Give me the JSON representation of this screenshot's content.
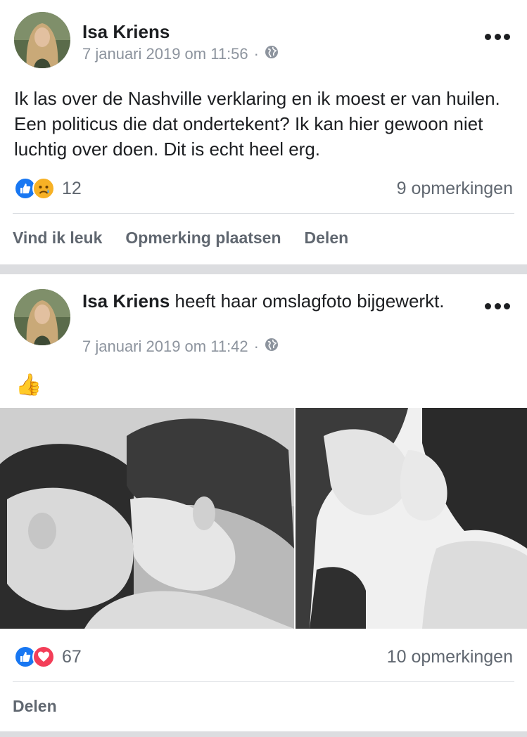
{
  "posts": [
    {
      "author": "Isa Kriens",
      "action": "",
      "date": "7 januari 2019 om 11:56",
      "separator": "·",
      "privacy_icon": "globe-icon",
      "text": "Ik las over de Nashville verklaring en ik moest er van huilen. Een politicus die dat ondertekent? Ik kan hier gewoon niet luchtig over doen. Dit is echt heel erg.",
      "reactions": [
        "like",
        "sad"
      ],
      "reaction_count": "12",
      "comments": "9 opmerkingen",
      "actions": [
        "Vind ik leuk",
        "Opmerking plaatsen",
        "Delen"
      ]
    },
    {
      "author": "Isa Kriens",
      "action": " heeft haar omslagfoto bijgewerkt.",
      "date": "7 januari 2019 om 11:42",
      "separator": "·",
      "privacy_icon": "globe-icon",
      "text_emoji": "👍",
      "reactions": [
        "like",
        "love"
      ],
      "reaction_count": "67",
      "comments": "10 opmerkingen",
      "actions": [
        "Delen"
      ]
    }
  ],
  "colors": {
    "like": "#1877f2",
    "love": "#f33e58",
    "sad": "#f7b125",
    "secondary_text": "#606770",
    "meta_text": "#8d949e",
    "divider": "#dcdde0"
  }
}
